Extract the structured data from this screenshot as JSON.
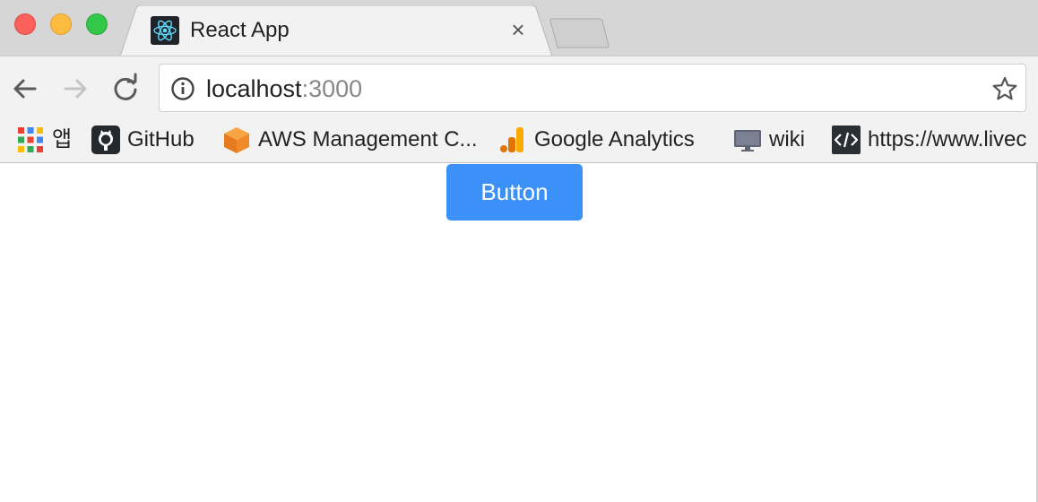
{
  "window": {
    "controls": [
      "close",
      "minimize",
      "zoom"
    ]
  },
  "tab": {
    "title": "React App",
    "favicon": "react-logo-icon",
    "close_glyph": "×"
  },
  "toolbar": {
    "back_icon": "arrow-left-icon",
    "forward_icon": "arrow-right-icon",
    "reload_icon": "reload-icon"
  },
  "address_bar": {
    "host": "localhost",
    "port": ":3000",
    "info_icon": "info-icon",
    "star_icon": "star-icon"
  },
  "bookmarks": [
    {
      "label": "앱",
      "icon": "apps-grid-icon"
    },
    {
      "label": "GitHub",
      "icon": "github-icon"
    },
    {
      "label": "AWS Management C...",
      "icon": "aws-cube-icon"
    },
    {
      "label": "Google Analytics",
      "icon": "google-analytics-icon"
    },
    {
      "label": "wiki",
      "icon": "monitor-icon"
    },
    {
      "label": "https://www.livec",
      "icon": "code-icon"
    }
  ],
  "page": {
    "button_label": "Button"
  },
  "colors": {
    "button_bg": "#3b91f7",
    "tabstrip_bg": "#d6d6d6",
    "toolbar_bg": "#f2f2f2"
  }
}
